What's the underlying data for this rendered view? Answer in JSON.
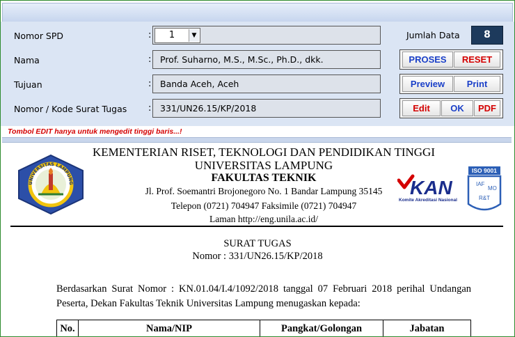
{
  "form": {
    "nomor_spd_label": "Nomor SPD",
    "nomor_spd_value": "1",
    "nama_label": "Nama",
    "nama_value": "Prof. Suharno, M.S., M.Sc., Ph.D., dkk.",
    "tujuan_label": "Tujuan",
    "tujuan_value": "Banda Aceh, Aceh",
    "surat_tugas_label": "Nomor / Kode Surat Tugas",
    "surat_tugas_value": "331/UN26.15/KP/2018",
    "colon": ":"
  },
  "jumlah": {
    "label": "Jumlah Data",
    "value": "8"
  },
  "buttons": {
    "proses": "PROSES",
    "reset": "RESET",
    "preview": "Preview",
    "print": "Print",
    "edit": "Edit",
    "ok": "OK",
    "pdf": "PDF"
  },
  "edit_note": "Tombol EDIT hanya untuk mengedit tinggi baris...!",
  "document": {
    "header": {
      "line1": "KEMENTERIAN RISET, TEKNOLOGI DAN PENDIDIKAN TINGGI",
      "line2": "UNIVERSITAS LAMPUNG",
      "line3": "FAKULTAS TEKNIK",
      "address": "Jl. Prof. Soemantri Brojonegoro No. 1 Bandar Lampung 35145",
      "phone": "Telepon (0721) 704947 Faksimile (0721) 704947",
      "web": "Laman http://eng.unila.ac.id/"
    },
    "logos": {
      "unila_text": "UNIVERSITAS LAMPUNG",
      "kan_text": "KAN",
      "kan_caption": "Komite Akreditasi Nasional",
      "iso_text": "ISO 9001",
      "iso_inner1": "IAF",
      "iso_inner2": "MO",
      "iso_inner3": "R&T"
    },
    "title": "SURAT TUGAS",
    "number": "Nomor : 331/UN26.15/KP/2018",
    "body": "Berdasarkan Surat Nomor : KN.01.04/I.4/1092/2018 tanggal 07 Februari 2018 perihal Undangan Peserta, Dekan Fakultas Teknik Universitas Lampung menugaskan kepada:",
    "table_headers": [
      "No.",
      "Nama/NIP",
      "Pangkat/Golongan",
      "Jabatan"
    ]
  },
  "colors": {
    "accent_blue": "#1a3fc8",
    "accent_red": "#d40000",
    "panel": "#dbe5f4",
    "counter_bg": "#1d3a5c"
  }
}
